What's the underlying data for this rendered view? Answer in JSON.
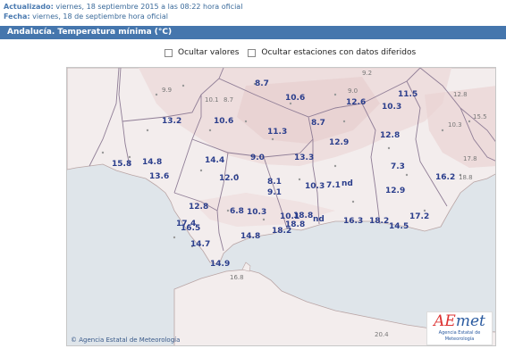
{
  "header": {
    "updated_label": "Actualizado:",
    "updated_value": "viernes, 18 septiembre 2015 a las 08:22 hora oficial",
    "date_label": "Fecha:",
    "date_value": "viernes, 18 de septiembre hora oficial"
  },
  "title": "Andalucía. Temperatura mínima (°C)",
  "options": {
    "hide_values": "Ocultar valores",
    "hide_stations": "Ocultar estaciones con datos diferidos"
  },
  "map": {
    "credit": "© Agencia Estatal de Meteorología",
    "logo_text_a": "AE",
    "logo_text_b": "met",
    "logo_sub": "Agencia Estatal de Meteorología",
    "stations": [
      {
        "v": "9.2",
        "small": true
      },
      {
        "v": "9.9",
        "small": true
      },
      {
        "v": "10.1",
        "small": true
      },
      {
        "v": "8.7",
        "small": true
      },
      {
        "v": "8.7",
        "small": false
      },
      {
        "v": "10.6",
        "small": false
      },
      {
        "v": "9.0",
        "small": true
      },
      {
        "v": "11.5",
        "small": false
      },
      {
        "v": "12.8",
        "small": true
      },
      {
        "v": "12.6",
        "small": false
      },
      {
        "v": "10.3",
        "small": false
      },
      {
        "v": "15.5",
        "small": true
      },
      {
        "v": "13.2",
        "small": false
      },
      {
        "v": "10.6",
        "small": false
      },
      {
        "v": "8.7",
        "small": false
      },
      {
        "v": "10.3",
        "small": true
      },
      {
        "v": "11.3",
        "small": false
      },
      {
        "v": "12.8",
        "small": false
      },
      {
        "v": "12.9",
        "small": false
      },
      {
        "v": "17.8",
        "small": true
      },
      {
        "v": "9.0",
        "small": false
      },
      {
        "v": "13.3",
        "small": false
      },
      {
        "v": "14.4",
        "small": false
      },
      {
        "v": "15.8",
        "small": false
      },
      {
        "v": "14.8",
        "small": false
      },
      {
        "v": "7.3",
        "small": false
      },
      {
        "v": "16.2",
        "small": false
      },
      {
        "v": "18.8",
        "small": true
      },
      {
        "v": "13.6",
        "small": false
      },
      {
        "v": "12.0",
        "small": false
      },
      {
        "v": "8.1",
        "small": false
      },
      {
        "v": "10.3",
        "small": false
      },
      {
        "v": "7.1",
        "small": false
      },
      {
        "v": "nd",
        "small": false
      },
      {
        "v": "9.1",
        "small": false
      },
      {
        "v": "12.9",
        "small": false
      },
      {
        "v": "12.8",
        "small": false
      },
      {
        "v": "6.8",
        "small": false
      },
      {
        "v": "10.3",
        "small": false
      },
      {
        "v": "10.1",
        "small": false
      },
      {
        "v": "18.8",
        "small": false
      },
      {
        "v": "18.8",
        "small": false
      },
      {
        "v": "nd",
        "small": false
      },
      {
        "v": "16.3",
        "small": false
      },
      {
        "v": "18.2",
        "small": false
      },
      {
        "v": "17.2",
        "small": false
      },
      {
        "v": "17.4",
        "small": false
      },
      {
        "v": "16.5",
        "small": false
      },
      {
        "v": "14.8",
        "small": false
      },
      {
        "v": "18.2",
        "small": false
      },
      {
        "v": "14.5",
        "small": false
      },
      {
        "v": "14.7",
        "small": false
      },
      {
        "v": "14.9",
        "small": false
      },
      {
        "v": "16.8",
        "small": true
      },
      {
        "v": "20.4",
        "small": true
      }
    ]
  }
}
